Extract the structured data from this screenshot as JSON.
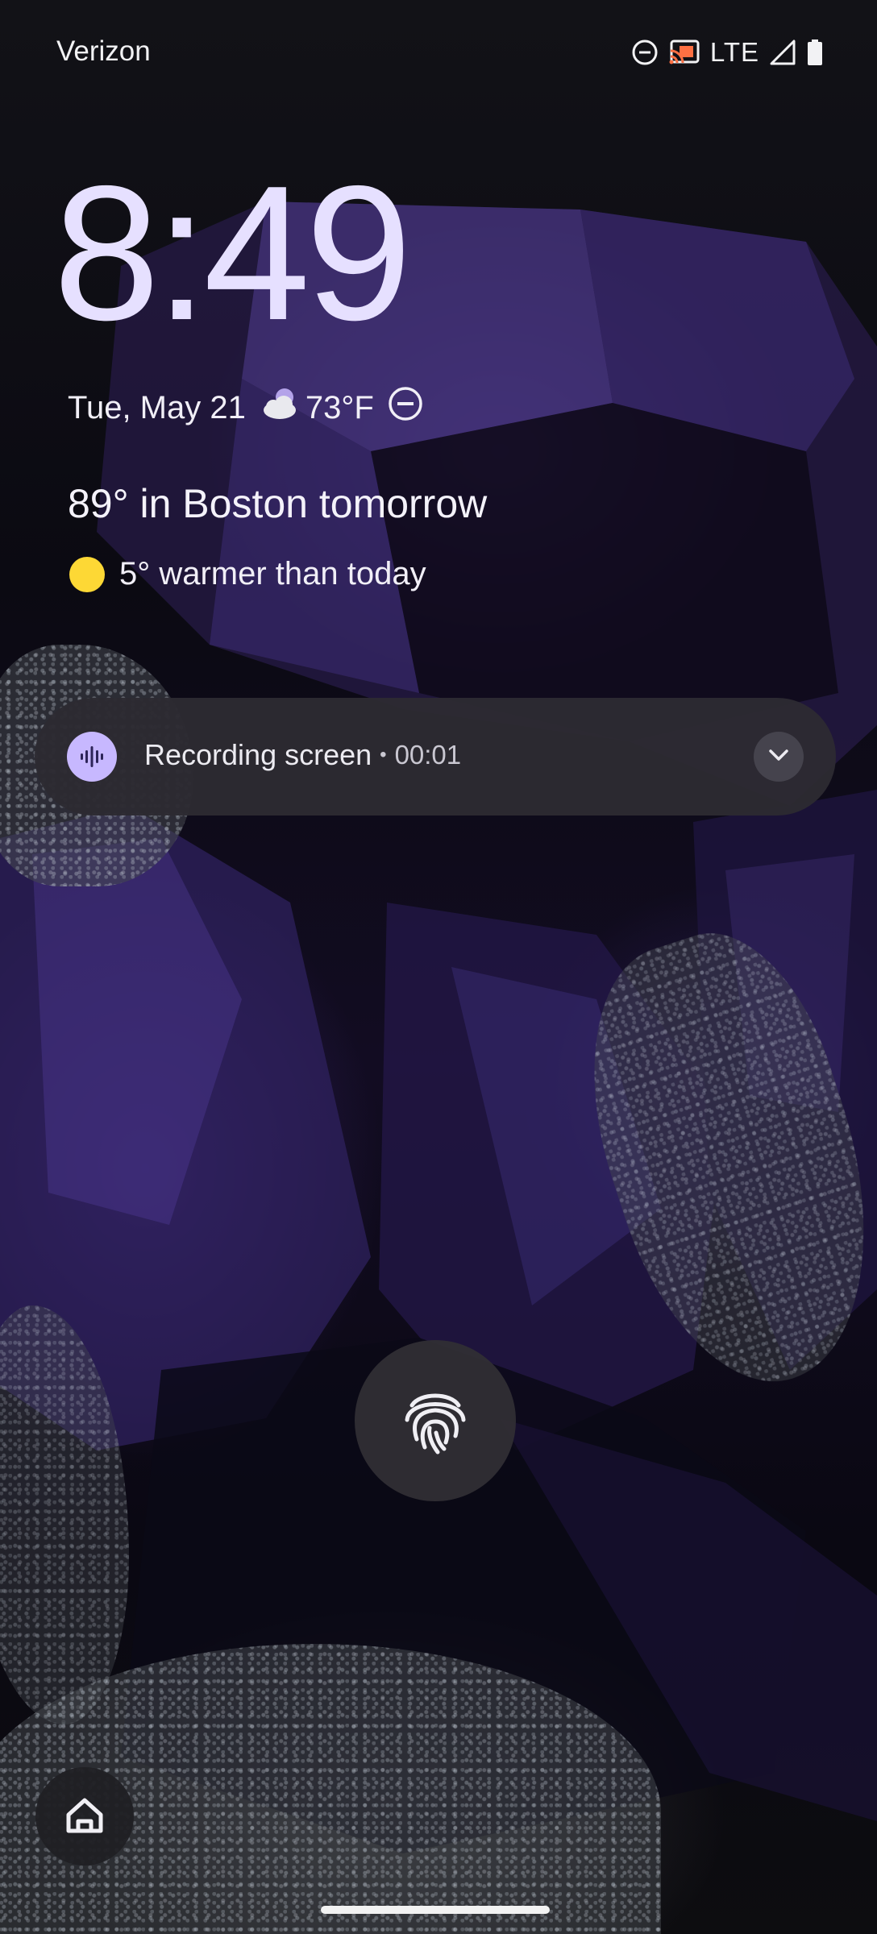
{
  "status_bar": {
    "carrier": "Verizon",
    "network": "LTE",
    "icons": [
      "do-not-disturb-icon",
      "cast-icon",
      "signal-icon",
      "battery-icon"
    ]
  },
  "lockscreen": {
    "time": "8:49",
    "date": "Tue, May 21",
    "current_temp": "73°F",
    "weather_icon": "partly-cloudy-night-icon",
    "forecast_headline": "89° in Boston tomorrow",
    "forecast_detail": "5° warmer than today"
  },
  "notification": {
    "title": "Recording screen",
    "separator": "•",
    "timer": "00:01",
    "app_icon": "sound-wave-icon",
    "accent_color": "#c7b8ff"
  },
  "bottom": {
    "unlock_icon": "fingerprint-icon",
    "shortcut_icon": "home-icon"
  }
}
